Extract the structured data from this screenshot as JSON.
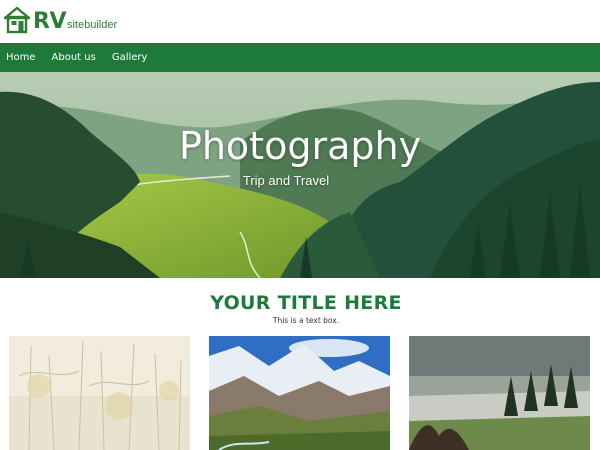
{
  "logo": {
    "brand": "RV",
    "sub": "sitebuilder",
    "icon": "house-icon"
  },
  "nav": {
    "items": [
      {
        "label": "Home"
      },
      {
        "label": "About us"
      },
      {
        "label": "Gallery"
      }
    ]
  },
  "hero": {
    "title": "Photography",
    "subtitle": "Trip and Travel"
  },
  "content": {
    "title": "YOUR TITLE HERE",
    "text": "This is a text box."
  },
  "colors": {
    "brand_green": "#1e7a3a",
    "logo_green": "#2e7d32"
  }
}
